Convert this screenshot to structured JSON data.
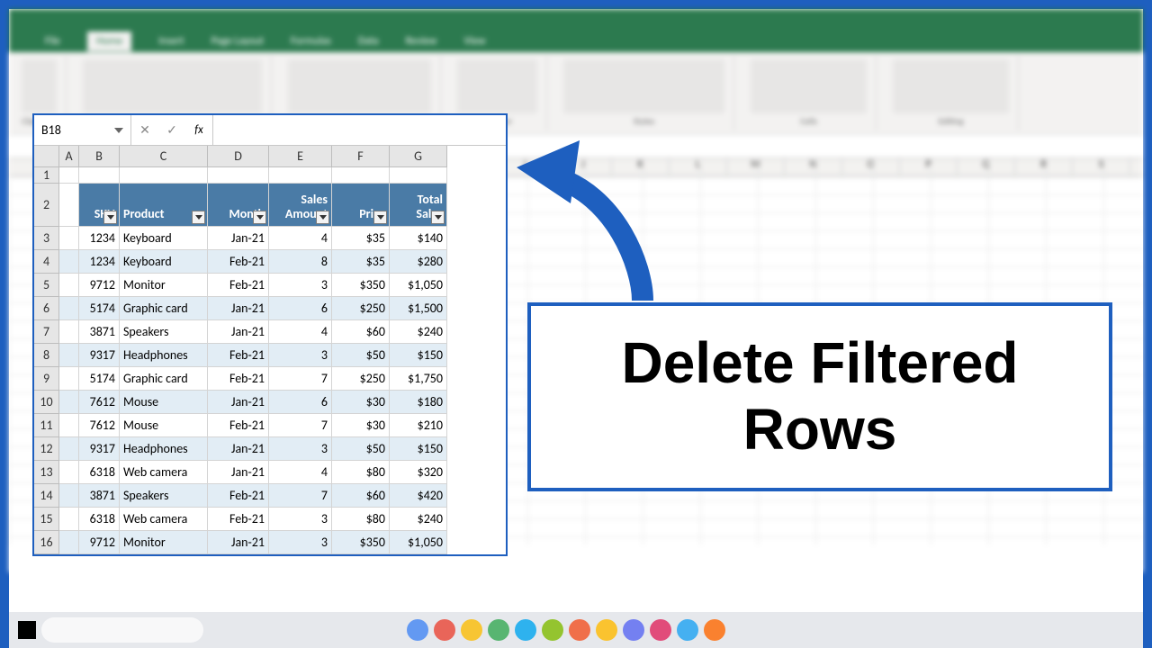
{
  "app": {
    "name_box_value": "B18",
    "formula_value": "",
    "fx_label": "fx"
  },
  "callout": {
    "text": "Delete Filtered Rows"
  },
  "columns": [
    "A",
    "B",
    "C",
    "D",
    "E",
    "F",
    "G"
  ],
  "row_numbers": [
    1,
    2,
    3,
    4,
    5,
    6,
    7,
    8,
    9,
    10,
    11,
    12,
    13,
    14,
    15,
    16
  ],
  "headers": {
    "sku": "SKU",
    "product": "Product",
    "month": "Month",
    "sales_amount": "Sales Amount",
    "price": "Price",
    "total_sales": "Total Sales"
  },
  "rows": [
    {
      "sku": "1234",
      "product": "Keyboard",
      "month": "Jan-21",
      "amount": "4",
      "price": "$35",
      "total": "$140"
    },
    {
      "sku": "1234",
      "product": "Keyboard",
      "month": "Feb-21",
      "amount": "8",
      "price": "$35",
      "total": "$280"
    },
    {
      "sku": "9712",
      "product": "Monitor",
      "month": "Feb-21",
      "amount": "3",
      "price": "$350",
      "total": "$1,050"
    },
    {
      "sku": "5174",
      "product": "Graphic card",
      "month": "Jan-21",
      "amount": "6",
      "price": "$250",
      "total": "$1,500"
    },
    {
      "sku": "3871",
      "product": "Speakers",
      "month": "Jan-21",
      "amount": "4",
      "price": "$60",
      "total": "$240"
    },
    {
      "sku": "9317",
      "product": "Headphones",
      "month": "Feb-21",
      "amount": "3",
      "price": "$50",
      "total": "$150"
    },
    {
      "sku": "5174",
      "product": "Graphic card",
      "month": "Feb-21",
      "amount": "7",
      "price": "$250",
      "total": "$1,750"
    },
    {
      "sku": "7612",
      "product": "Mouse",
      "month": "Jan-21",
      "amount": "6",
      "price": "$30",
      "total": "$180"
    },
    {
      "sku": "7612",
      "product": "Mouse",
      "month": "Feb-21",
      "amount": "7",
      "price": "$30",
      "total": "$210"
    },
    {
      "sku": "9317",
      "product": "Headphones",
      "month": "Jan-21",
      "amount": "3",
      "price": "$50",
      "total": "$150"
    },
    {
      "sku": "6318",
      "product": "Web camera",
      "month": "Jan-21",
      "amount": "4",
      "price": "$80",
      "total": "$320"
    },
    {
      "sku": "3871",
      "product": "Speakers",
      "month": "Feb-21",
      "amount": "7",
      "price": "$60",
      "total": "$420"
    },
    {
      "sku": "6318",
      "product": "Web camera",
      "month": "Feb-21",
      "amount": "3",
      "price": "$80",
      "total": "$240"
    },
    {
      "sku": "9712",
      "product": "Monitor",
      "month": "Jan-21",
      "amount": "3",
      "price": "$350",
      "total": "$1,050"
    }
  ],
  "taskbar_colors": [
    "#4285f4",
    "#ea4335",
    "#fbbc05",
    "#34a853",
    "#00a4ef",
    "#7fba00",
    "#f25022",
    "#ffb900",
    "#5865f2",
    "#e0245e",
    "#1da1f2",
    "#ff6600"
  ]
}
